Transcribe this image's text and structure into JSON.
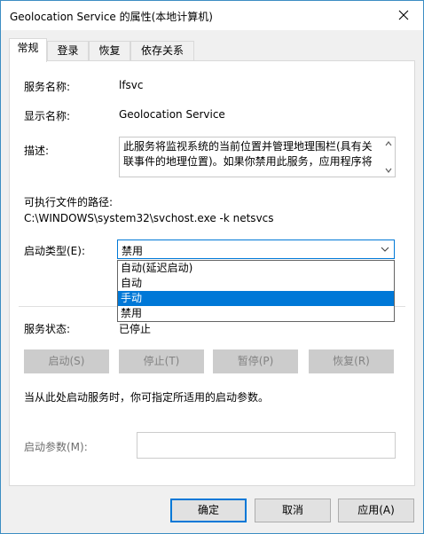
{
  "window": {
    "title": "Geolocation Service 的属性(本地计算机)"
  },
  "tabs": [
    {
      "label": "常规",
      "active": true
    },
    {
      "label": "登录",
      "active": false
    },
    {
      "label": "恢复",
      "active": false
    },
    {
      "label": "依存关系",
      "active": false
    }
  ],
  "general": {
    "service_name_label": "服务名称:",
    "service_name_value": "lfsvc",
    "display_name_label": "显示名称:",
    "display_name_value": "Geolocation Service",
    "description_label": "描述:",
    "description_value": "此服务将监视系统的当前位置并管理地理围栏(具有关联事件的地理位置)。如果你禁用此服务，应用程序将",
    "exe_path_label": "可执行文件的路径:",
    "exe_path_value": "C:\\WINDOWS\\system32\\svchost.exe -k netsvcs",
    "startup_type_label": "启动类型(E):",
    "startup_type_value": "禁用",
    "startup_options": [
      "自动(延迟启动)",
      "自动",
      "手动",
      "禁用"
    ],
    "highlighted_option": "手动",
    "service_status_label": "服务状态:",
    "service_status_value": "已停止",
    "start_button": "启动(S)",
    "stop_button": "停止(T)",
    "pause_button": "暂停(P)",
    "resume_button": "恢复(R)",
    "hint_text": "当从此处启动服务时，你可指定所适用的启动参数。",
    "start_params_label": "启动参数(M):",
    "start_params_value": ""
  },
  "footer": {
    "ok_button": "确定",
    "cancel_button": "取消",
    "apply_button": "应用(A)"
  },
  "colors": {
    "accent": "#0078d7",
    "window_border": "#3c8dc3",
    "disabled_button": "#cccccc"
  }
}
